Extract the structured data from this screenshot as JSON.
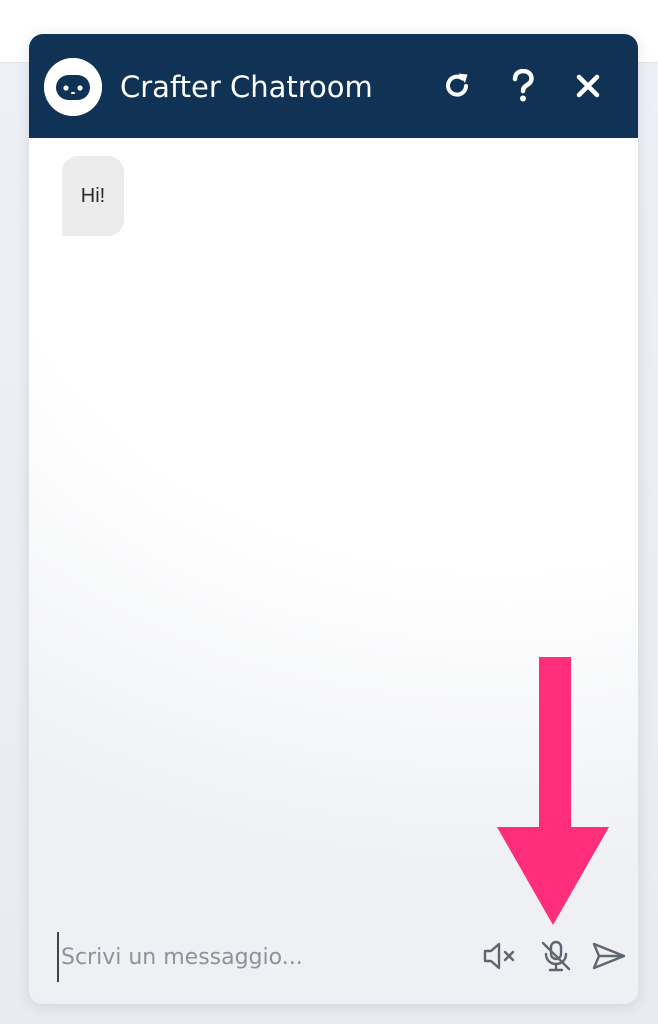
{
  "header": {
    "title": "Crafter Chatroom",
    "background_color": "#103255",
    "avatar_icon": "robot-face-icon",
    "buttons": [
      {
        "name": "refresh-button",
        "icon": "refresh-icon"
      },
      {
        "name": "help-button",
        "icon": "question-mark-icon"
      },
      {
        "name": "close-button",
        "icon": "close-icon"
      }
    ]
  },
  "messages": [
    {
      "from": "bot",
      "text": "Hi!"
    }
  ],
  "composer": {
    "placeholder": "Scrivi un messaggio...",
    "value": "",
    "buttons": [
      {
        "name": "mute-audio-button",
        "icon": "speaker-muted-icon"
      },
      {
        "name": "microphone-button",
        "icon": "microphone-off-icon"
      },
      {
        "name": "send-button",
        "icon": "send-icon"
      }
    ]
  },
  "annotation": {
    "icon": "down-arrow-icon",
    "color": "#ff2d7a"
  }
}
